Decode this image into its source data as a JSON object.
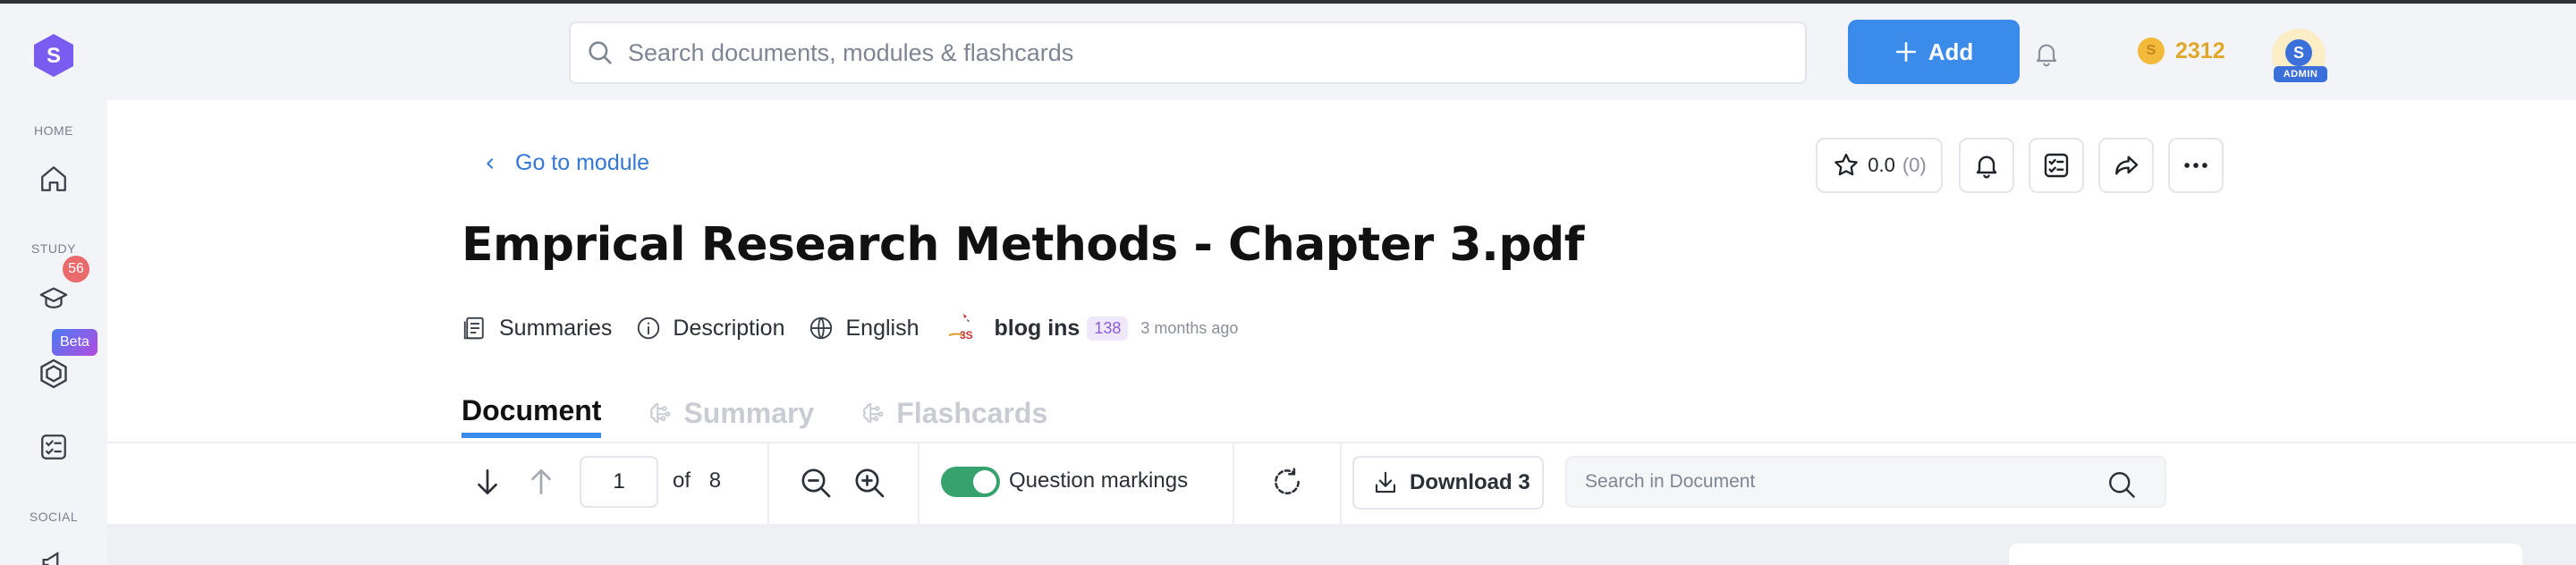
{
  "sidebar": {
    "logo_letter": "S",
    "sections": {
      "home": "HOME",
      "study": "STUDY",
      "social": "SOCIAL"
    },
    "study_badge": "56",
    "beta_badge": "Beta"
  },
  "header": {
    "search_placeholder": "Search documents, modules & flashcards",
    "add_label": "Add",
    "coins": "2312",
    "coin_symbol": "S",
    "avatar_letter": "S",
    "avatar_role": "ADMIN"
  },
  "doc": {
    "back_label": "Go to module",
    "rating_value": "0.0",
    "rating_count": "(0)",
    "title": "Emprical Research Methods - Chapter 3.pdf",
    "meta": {
      "summaries": "Summaries",
      "description": "Description",
      "language": "English",
      "author": "blog ins",
      "author_score": "138",
      "time_ago": "3 months ago"
    },
    "tabs": [
      "Document",
      "Summary",
      "Flashcards"
    ]
  },
  "toolbar": {
    "page_current": "1",
    "page_of": "of",
    "page_total": "8",
    "question_markings_label": "Question markings",
    "question_markings_on": true,
    "download_label": "Download 3",
    "search_placeholder": "Search in Document"
  },
  "colors": {
    "accent": "#3b8beb",
    "brand": "#7b5cf0",
    "coin": "#e0a72b",
    "toggle_on": "#37a26d"
  }
}
